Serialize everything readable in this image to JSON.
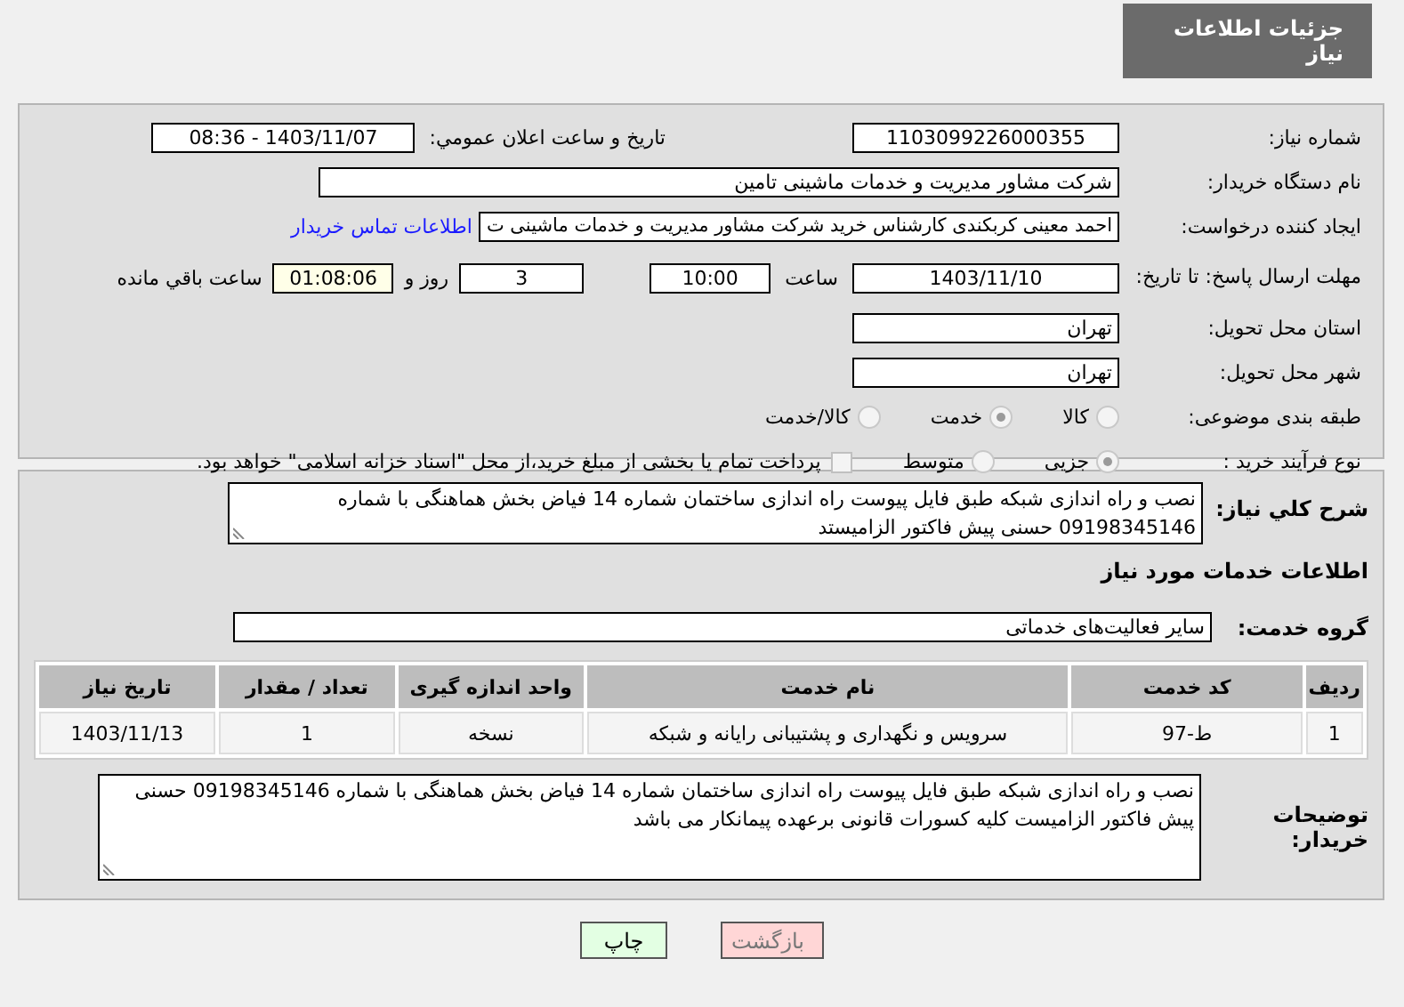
{
  "header": {
    "title": "جزئیات اطلاعات نیاز"
  },
  "details": {
    "need_number": {
      "label": "شماره نیاز:",
      "value": "1103099226000355"
    },
    "announce": {
      "label": "تاریخ و ساعت اعلان عمومي:",
      "value": "1403/11/07 - 08:36"
    },
    "buyer": {
      "label": "نام دستگاه خریدار:",
      "value": "شرکت مشاور مدیریت و خدمات ماشینی تامین"
    },
    "creator": {
      "label": "ایجاد کننده درخواست:",
      "value": "احمد معینی کربکندی کارشناس خرید شرکت مشاور مدیریت و خدمات ماشینی ت",
      "link": "اطلاعات تماس خریدار"
    },
    "deadline": {
      "label": "مهلت ارسال پاسخ: تا تاریخ:",
      "date": "1403/11/10",
      "time_label": "ساعت",
      "time": "10:00",
      "days": "3",
      "days_label": "روز و",
      "remaining": "01:08:06",
      "remaining_label": "ساعت باقي مانده"
    },
    "province": {
      "label": "استان محل تحویل:",
      "value": "تهران"
    },
    "city": {
      "label": "شهر محل تحویل:",
      "value": "تهران"
    },
    "category": {
      "label": "طبقه بندی موضوعی:",
      "options": [
        {
          "label": "كالا",
          "selected": false
        },
        {
          "label": "خدمت",
          "selected": true
        },
        {
          "label": "كالا/خدمت",
          "selected": false
        }
      ]
    },
    "process": {
      "label": "نوع فرآیند خرید :",
      "options": [
        {
          "label": "جزیی",
          "selected": true
        },
        {
          "label": "متوسط",
          "selected": false
        }
      ],
      "payment": {
        "label": "پرداخت تمام یا بخشی از مبلغ خرید،از محل \"اسناد خزانه اسلامی\" خواهد بود.",
        "checked": false
      }
    }
  },
  "summary": {
    "label": "شرح کلي نياز:",
    "value": "نصب و راه اندازی شبکه طبق فایل پیوست  راه اندازی ساختمان شماره 14 فیاض بخش هماهنگی با شماره 09198345146 حسنی  پیش فاکتور الزامیستد"
  },
  "services_heading": "اطلاعات خدمات مورد نیاز",
  "service_group": {
    "label": "گروه خدمت:",
    "value": "سایر فعالیت‌های خدماتی"
  },
  "table": {
    "columns": [
      "ردیف",
      "کد خدمت",
      "نام خدمت",
      "واحد اندازه گیری",
      "تعداد / مقدار",
      "تاریخ نیاز"
    ],
    "rows": [
      [
        "1",
        "ط-97",
        "سرویس و نگهداری و پشتیبانی رایانه و شبکه",
        "نسخه",
        "1",
        "1403/11/13"
      ]
    ]
  },
  "notes": {
    "label": "توضیحات خریدار:",
    "value": "نصب و راه اندازی شبکه طبق فایل پیوست  راه اندازی ساختمان شماره 14 فیاض بخش هماهنگی با شماره 09198345146 حسنی  پیش فاکتور الزامیست  کلیه  کسورات قانونی برعهده پیمانکار می باشد"
  },
  "buttons": [
    {
      "label": "بازگشت",
      "kind": "back"
    },
    {
      "label": "چاپ",
      "kind": "print"
    }
  ]
}
